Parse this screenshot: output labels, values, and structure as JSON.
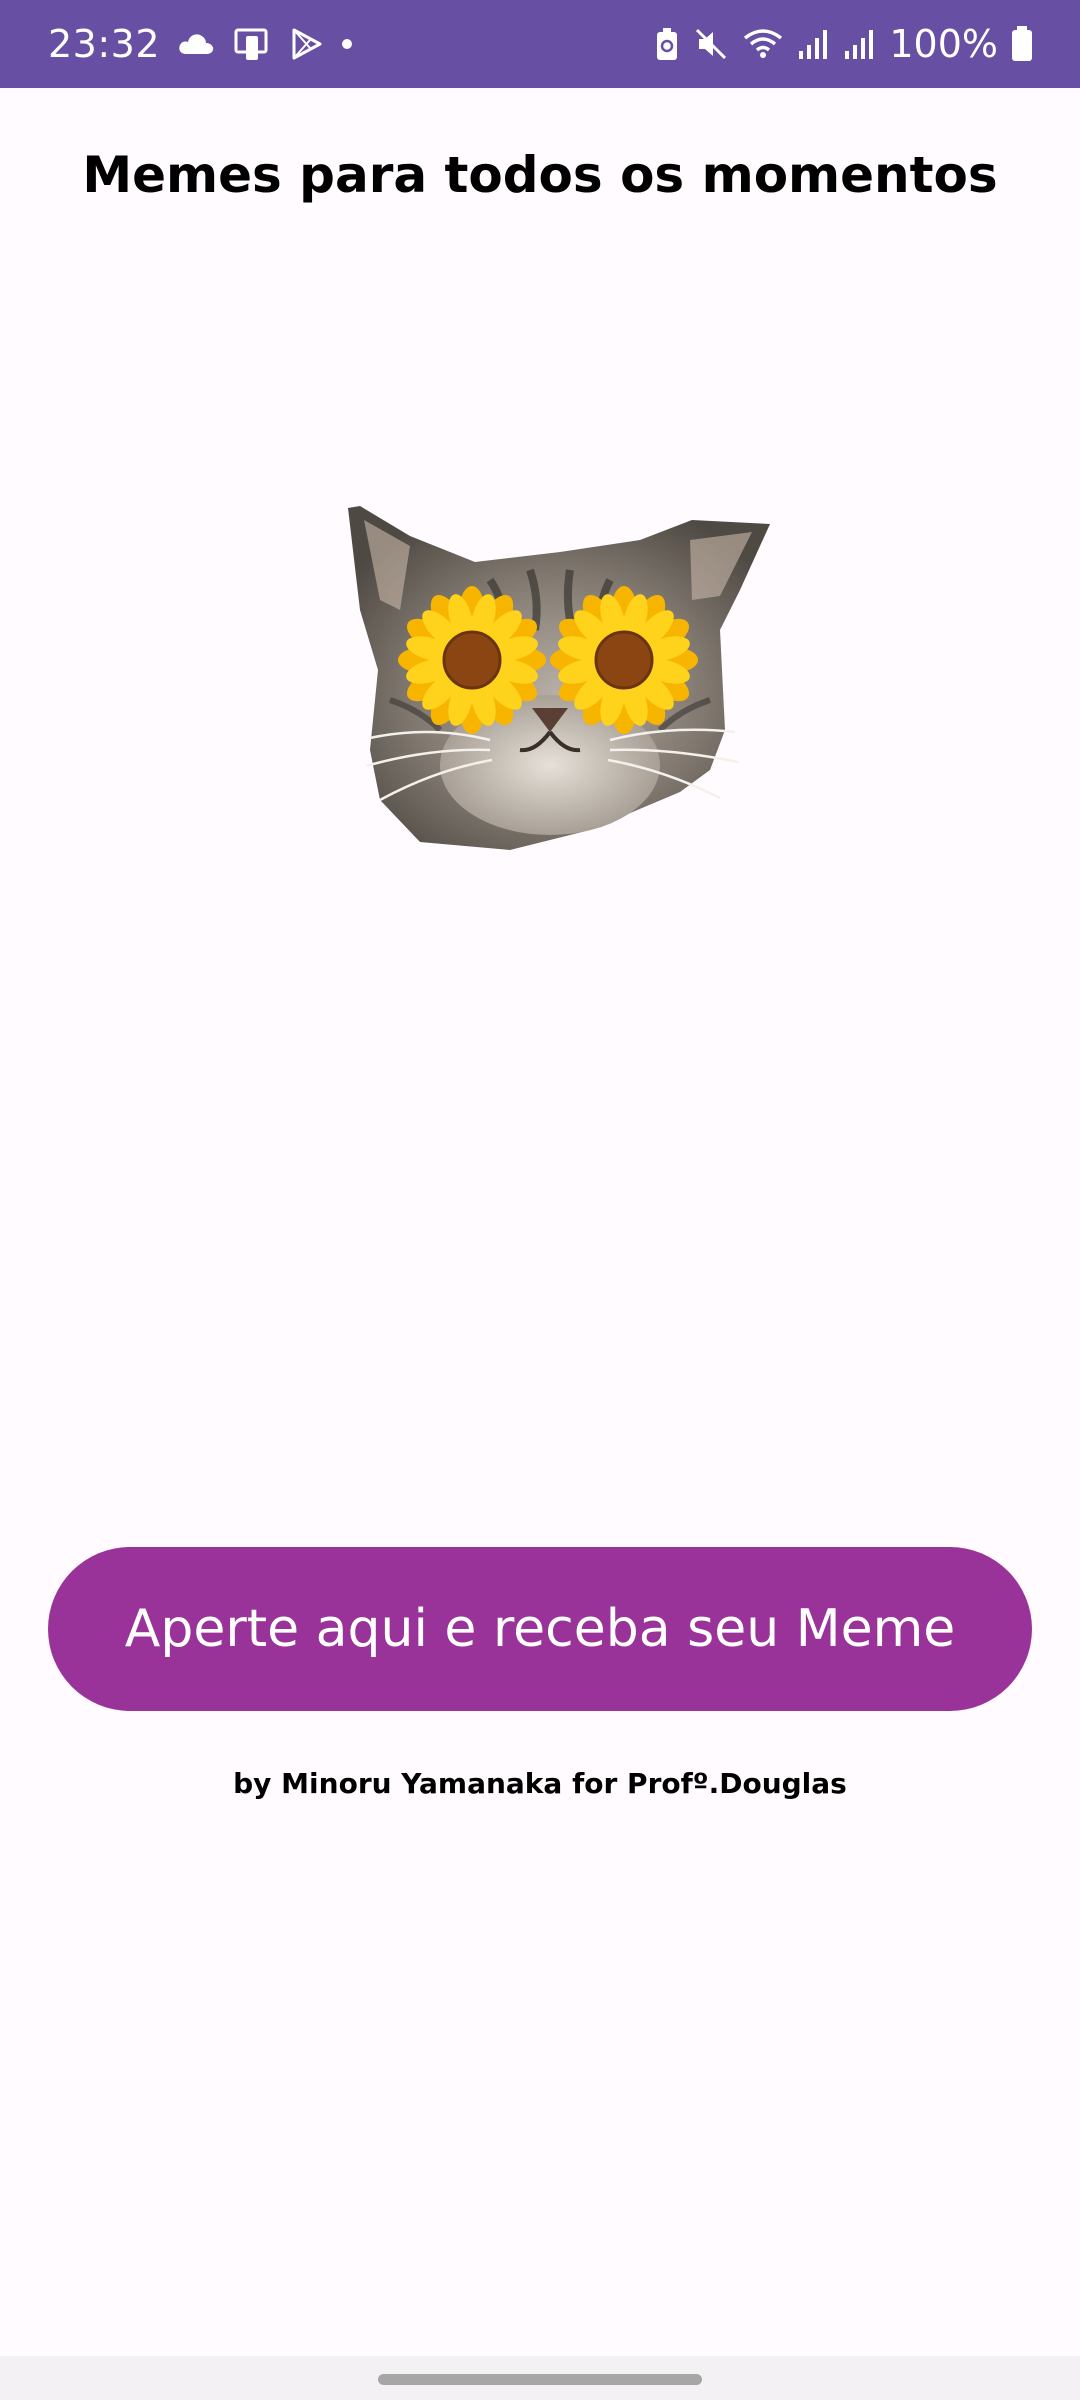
{
  "status_bar": {
    "time": "23:32",
    "battery_percent": "100%",
    "background_color": "#6750a4",
    "left_icons": [
      "cloud-icon",
      "device-screen-icon",
      "play-store-icon",
      "notification-dot-icon"
    ],
    "right_icons": [
      "battery-saver-icon",
      "mute-icon",
      "wifi-icon",
      "signal-icon-1",
      "signal-icon-2",
      "battery-icon"
    ]
  },
  "main": {
    "title": "Memes para todos os momentos",
    "image_icon": "cat-with-sunflower-eyes",
    "button_label": "Aperte aqui e receba seu Meme",
    "button_color": "#993399",
    "credit": "by Minoru Yamanaka for Profº.Douglas"
  }
}
